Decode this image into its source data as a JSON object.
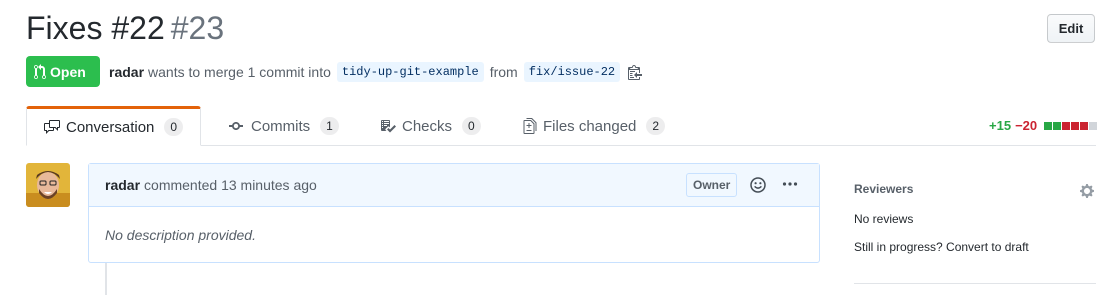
{
  "pr": {
    "title": "Fixes #22",
    "number": "#23",
    "edit_label": "Edit",
    "state_label": "Open",
    "author": "radar",
    "merge_text": "wants to merge 1 commit into",
    "base_branch": "tidy-up-git-example",
    "from_text": "from",
    "head_branch": "fix/issue-22"
  },
  "tabs": [
    {
      "label": "Conversation",
      "count": "0",
      "icon": "comment-discussion-icon"
    },
    {
      "label": "Commits",
      "count": "1",
      "icon": "commit-icon"
    },
    {
      "label": "Checks",
      "count": "0",
      "icon": "checklist-icon"
    },
    {
      "label": "Files changed",
      "count": "2",
      "icon": "file-diff-icon"
    }
  ],
  "diffstat": {
    "additions": "+15",
    "deletions": "−20",
    "blocks": [
      "add",
      "add",
      "del",
      "del",
      "del",
      "neutral"
    ]
  },
  "comment": {
    "author": "radar",
    "action_text": "commented 13 minutes ago",
    "badge": "Owner",
    "body": "No description provided."
  },
  "sidebar": {
    "reviewers_title": "Reviewers",
    "no_reviews": "No reviews",
    "draft_link": "Still in progress? Convert to draft"
  },
  "colors": {
    "open_green": "#2cbe4e",
    "add_green": "#28a745",
    "del_red": "#cb2431",
    "active_tab": "#e36209",
    "link_blue": "#0366d6"
  }
}
